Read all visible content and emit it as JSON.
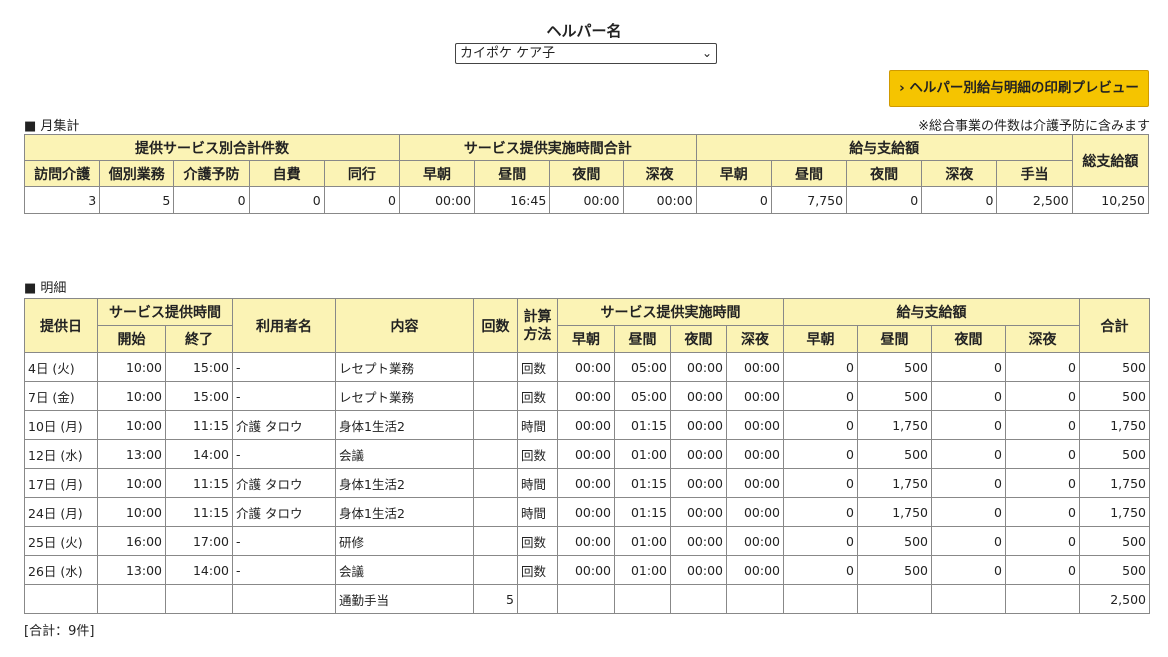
{
  "helper": {
    "title": "ヘルパー名",
    "selected": "カイポケ ケア子",
    "print_preview": "ヘルパー別給与明細の印刷プレビュー"
  },
  "monthly": {
    "label": "■ 月集計",
    "note": "※総合事業の件数は介護予防に含みます",
    "groups": {
      "service_count": "提供サービス別合計件数",
      "service_time": "サービス提供実施時間合計",
      "salary": "給与支給額",
      "total": "総支給額"
    },
    "headers": [
      "訪問介護",
      "個別業務",
      "介護予防",
      "自費",
      "同行",
      "早朝",
      "昼間",
      "夜間",
      "深夜",
      "早朝",
      "昼間",
      "夜間",
      "深夜",
      "手当"
    ],
    "values": [
      "3",
      "5",
      "0",
      "0",
      "0",
      "00:00",
      "16:45",
      "00:00",
      "00:00",
      "0",
      "7,750",
      "0",
      "0",
      "2,500",
      "10,250"
    ]
  },
  "detail": {
    "label": "■ 明細",
    "headers": {
      "date": "提供日",
      "service_hours": "サービス提供時間",
      "start": "開始",
      "end": "終了",
      "user": "利用者名",
      "content": "内容",
      "count": "回数",
      "calc": "計算方法",
      "impl_time": "サービス提供実施時間",
      "salary": "給与支給額",
      "total": "合計",
      "early": "早朝",
      "day": "昼間",
      "evening": "夜間",
      "night": "深夜"
    },
    "rows": [
      [
        "4日 (火)",
        "10:00",
        "15:00",
        "-",
        "レセプト業務",
        "",
        "回数",
        "00:00",
        "05:00",
        "00:00",
        "00:00",
        "0",
        "500",
        "0",
        "0",
        "500"
      ],
      [
        "7日 (金)",
        "10:00",
        "15:00",
        "-",
        "レセプト業務",
        "",
        "回数",
        "00:00",
        "05:00",
        "00:00",
        "00:00",
        "0",
        "500",
        "0",
        "0",
        "500"
      ],
      [
        "10日 (月)",
        "10:00",
        "11:15",
        "介護 タロウ",
        "身体1生活2",
        "",
        "時間",
        "00:00",
        "01:15",
        "00:00",
        "00:00",
        "0",
        "1,750",
        "0",
        "0",
        "1,750"
      ],
      [
        "12日 (水)",
        "13:00",
        "14:00",
        "-",
        "会議",
        "",
        "回数",
        "00:00",
        "01:00",
        "00:00",
        "00:00",
        "0",
        "500",
        "0",
        "0",
        "500"
      ],
      [
        "17日 (月)",
        "10:00",
        "11:15",
        "介護 タロウ",
        "身体1生活2",
        "",
        "時間",
        "00:00",
        "01:15",
        "00:00",
        "00:00",
        "0",
        "1,750",
        "0",
        "0",
        "1,750"
      ],
      [
        "24日 (月)",
        "10:00",
        "11:15",
        "介護 タロウ",
        "身体1生活2",
        "",
        "時間",
        "00:00",
        "01:15",
        "00:00",
        "00:00",
        "0",
        "1,750",
        "0",
        "0",
        "1,750"
      ],
      [
        "25日 (火)",
        "16:00",
        "17:00",
        "-",
        "研修",
        "",
        "回数",
        "00:00",
        "01:00",
        "00:00",
        "00:00",
        "0",
        "500",
        "0",
        "0",
        "500"
      ],
      [
        "26日 (水)",
        "13:00",
        "14:00",
        "-",
        "会議",
        "",
        "回数",
        "00:00",
        "01:00",
        "00:00",
        "00:00",
        "0",
        "500",
        "0",
        "0",
        "500"
      ],
      [
        "",
        "",
        "",
        "",
        "通勤手当",
        "5",
        "",
        "",
        "",
        "",
        "",
        "",
        "",
        "",
        "",
        "2,500"
      ]
    ],
    "footer": "[合計：9件]"
  }
}
